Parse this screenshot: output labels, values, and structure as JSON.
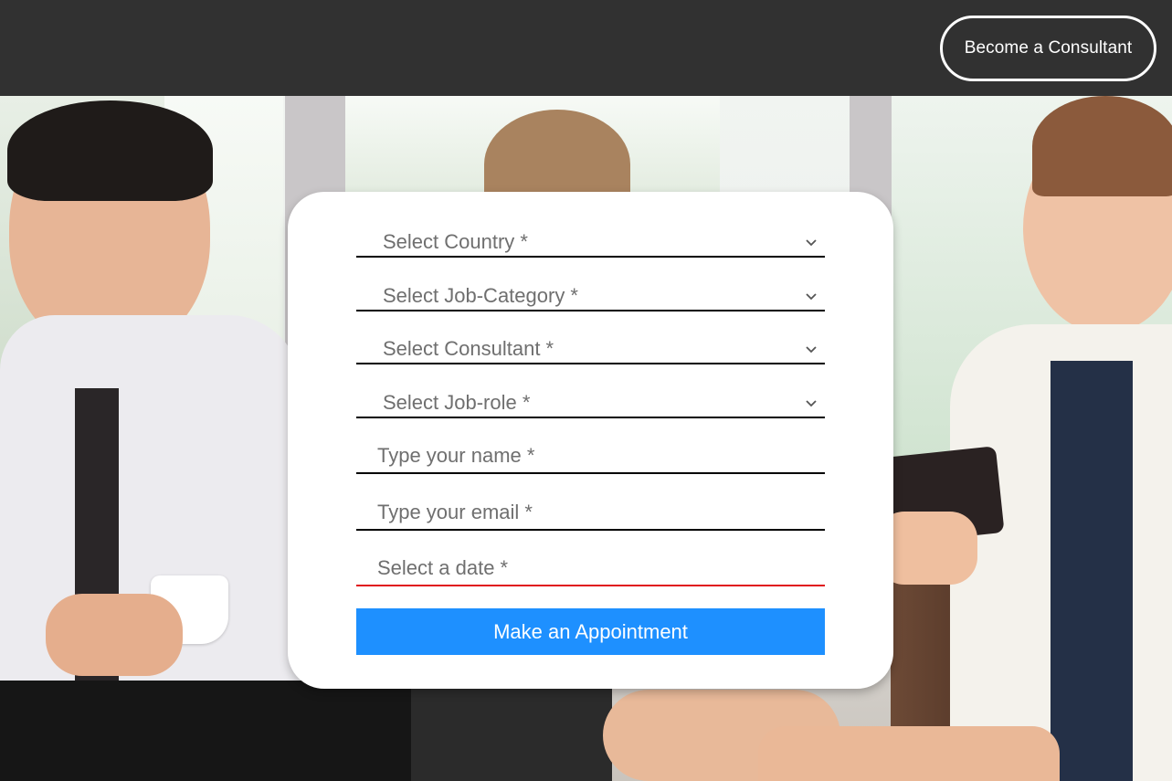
{
  "header": {
    "become_consultant_label": "Become a Consultant"
  },
  "form": {
    "country_select": "Select Country *",
    "job_category_select": "Select Job-Category *",
    "consultant_select": "Select Consultant *",
    "job_role_select": "Select Job-role *",
    "name_placeholder": "Type your name *",
    "email_placeholder": "Type your email *",
    "date_placeholder": "Select a date *",
    "submit_label": "Make an Appointment"
  },
  "colors": {
    "topbar": "#313131",
    "button_accent": "#1e90ff",
    "date_underline": "#e0141b"
  },
  "icons": {
    "dropdown": "chevron-down-icon"
  }
}
